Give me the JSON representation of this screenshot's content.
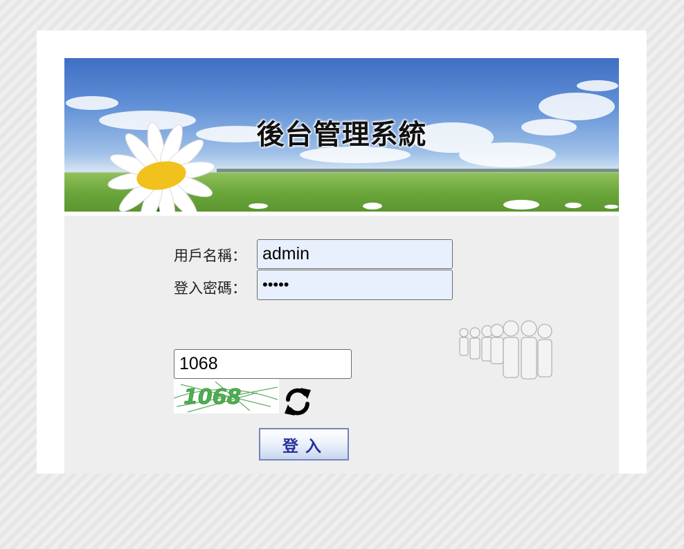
{
  "banner": {
    "title": "後台管理系統",
    "colors": {
      "sky": "#4f80cc",
      "grass": "#6aa63a",
      "petal": "#ffffff",
      "center": "#f2c21c"
    }
  },
  "form": {
    "username_label": "用戶名稱：",
    "username_value": "admin",
    "password_label": "登入密碼：",
    "password_value": "•••••",
    "captcha_value": "1068",
    "captcha_image_text": "1068",
    "login_label": "登入"
  },
  "colors": {
    "field_autofill_bg": "#e8f0fe",
    "panel_bg": "#eeeeee",
    "button_text": "#27309a",
    "captcha_text": "#4caf50"
  },
  "icons": {
    "refresh": "refresh-icon",
    "people": "people-group-icon"
  }
}
